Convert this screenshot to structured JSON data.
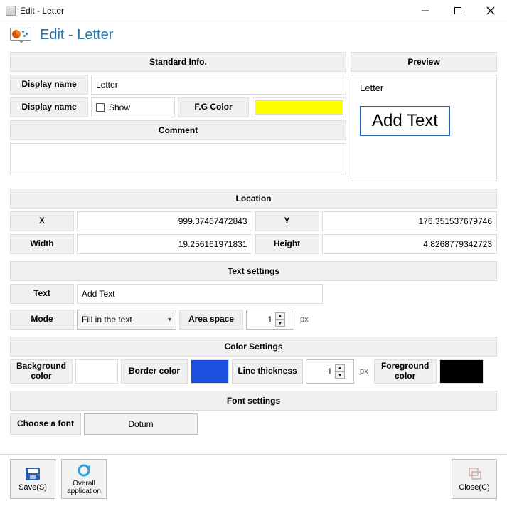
{
  "window": {
    "title": "Edit - Letter"
  },
  "header": {
    "title": "Edit - Letter"
  },
  "standard": {
    "head": "Standard Info.",
    "displayname_label": "Display name",
    "displayname_value": "Letter",
    "displayname_label2": "Display name",
    "show_label": "Show",
    "show_checked": false,
    "fgcolor_label": "F.G Color",
    "fgcolor_value": "#ffff00",
    "comment_label": "Comment",
    "comment_value": ""
  },
  "preview": {
    "head": "Preview",
    "name": "Letter",
    "text": "Add Text"
  },
  "location": {
    "head": "Location",
    "x_label": "X",
    "x_value": "999.37467472843",
    "y_label": "Y",
    "y_value": "176.351537679746",
    "w_label": "Width",
    "w_value": "19.256161971831",
    "h_label": "Height",
    "h_value": "4.8268779342723"
  },
  "textsettings": {
    "head": "Text settings",
    "text_label": "Text",
    "text_value": "Add Text",
    "mode_label": "Mode",
    "mode_value": "Fill in the text",
    "area_label": "Area space",
    "area_value": "1",
    "area_unit": "px"
  },
  "colorsettings": {
    "head": "Color Settings",
    "bg_label": "Background color",
    "bg_value": "#ffffff",
    "border_label": "Border color",
    "border_value": "#1a4fe0",
    "thick_label": "Line thickness",
    "thick_value": "1",
    "thick_unit": "px",
    "fg_label": "Foreground color",
    "fg_value": "#000000"
  },
  "fontsettings": {
    "head": "Font settings",
    "choose_label": "Choose a font",
    "font_name": "Dotum"
  },
  "actions": {
    "save": "Save(S)",
    "overall": "Overall application",
    "close": "Close(C)"
  }
}
